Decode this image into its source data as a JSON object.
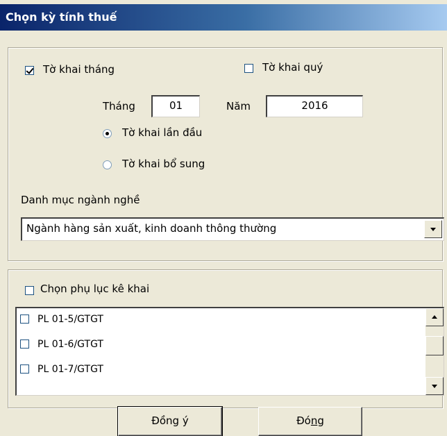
{
  "window": {
    "title": "Chọn kỳ tính thuế"
  },
  "period": {
    "monthly_label": "Tờ khai tháng",
    "monthly_checked": true,
    "quarterly_label": "Tờ khai quý",
    "quarterly_checked": false,
    "month_label": "Tháng",
    "month_value": "01",
    "year_label": "Năm",
    "year_value": "2016",
    "initial_label": "Tờ khai lần đầu",
    "supplement_label": "Tờ khai bổ sung",
    "selected_type": "initial"
  },
  "industry": {
    "label": "Danh mục ngành nghề",
    "selected": "Ngành hàng sản xuất, kinh doanh thông thường"
  },
  "appendix": {
    "label": "Chọn phụ lục kê khai",
    "checked": false,
    "items": [
      {
        "label": "PL 01-5/GTGT",
        "checked": false
      },
      {
        "label": "PL 01-6/GTGT",
        "checked": false
      },
      {
        "label": "PL 01-7/GTGT",
        "checked": false
      }
    ]
  },
  "buttons": {
    "ok_label": "Đồng ý",
    "close_label": "Đóng"
  }
}
